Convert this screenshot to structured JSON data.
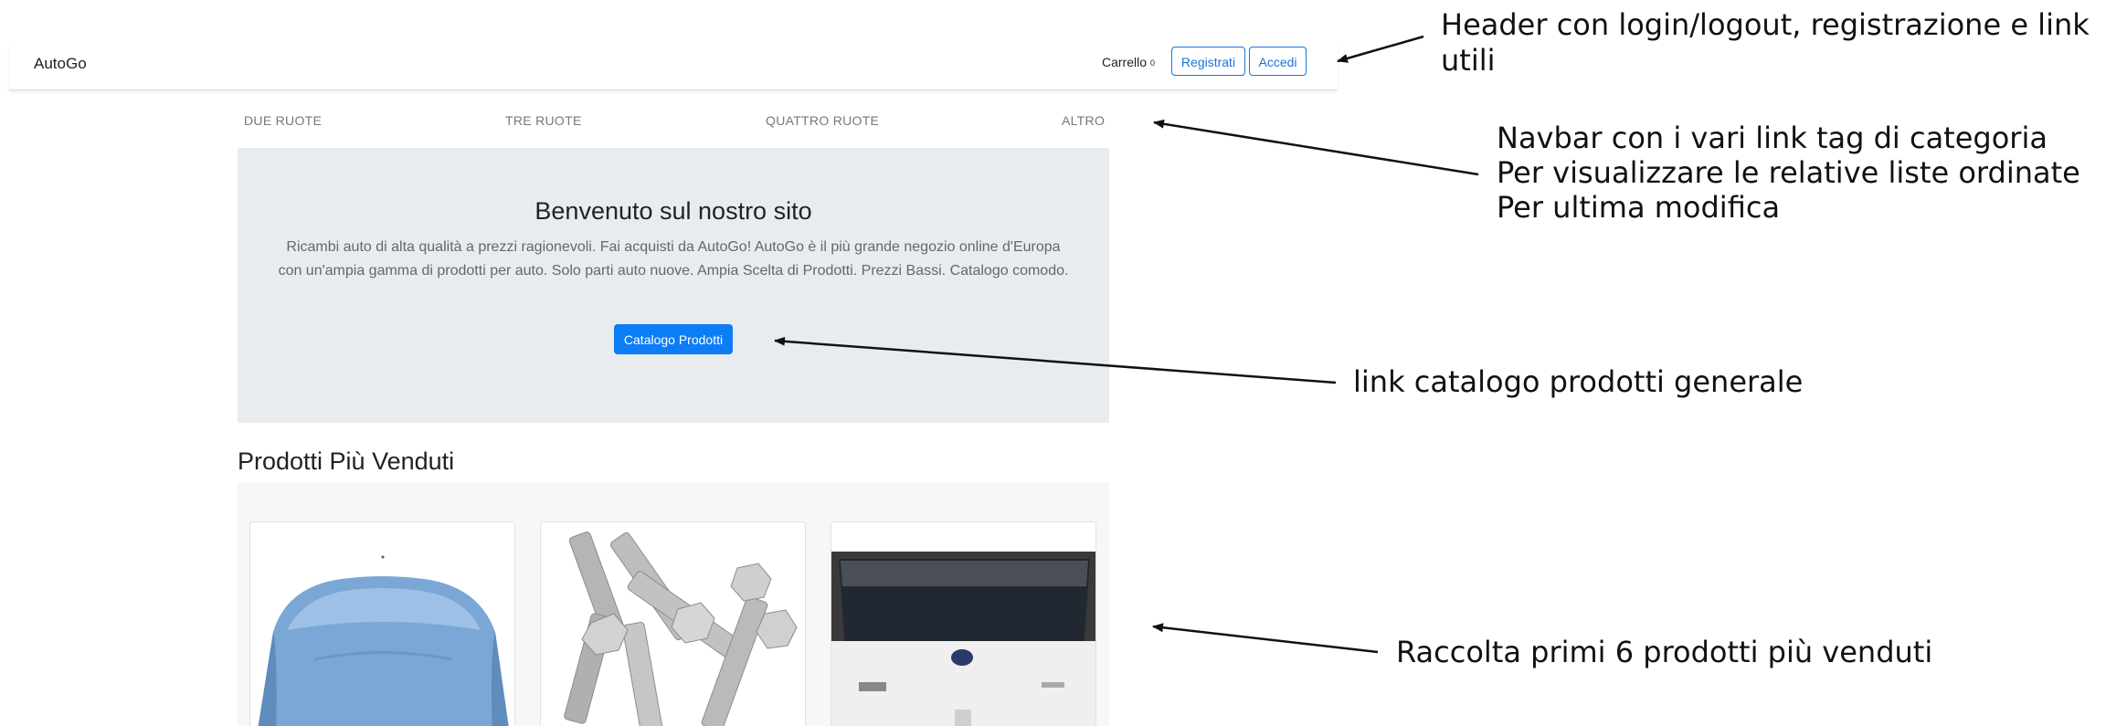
{
  "header": {
    "brand": "AutoGo",
    "cart_label": "Carrello",
    "cart_count": "0",
    "register_label": "Registrati",
    "login_label": "Accedi"
  },
  "category_nav": [
    "DUE RUOTE",
    "TRE RUOTE",
    "QUATTRO RUOTE",
    "ALTRO"
  ],
  "hero": {
    "title": "Benvenuto sul nostro sito",
    "text": "Ricambi auto di alta qualità a prezzi ragionevoli. Fai acquisti da AutoGo! AutoGo è il più grande negozio online d'Europa con un'ampia gamma di prodotti per auto. Solo parti auto nuove. Ampia Scelta di Prodotti. Prezzi Bassi. Catalogo comodo.",
    "button_label": "Catalogo Prodotti"
  },
  "best_sellers": {
    "title": "Prodotti Più Venduti",
    "products": [
      {
        "image": "blue-car-hood"
      },
      {
        "image": "steel-bolts"
      },
      {
        "image": "white-car-tailgate"
      }
    ]
  },
  "annotations": {
    "header_note": "Header con login/logout, registrazione e link utili",
    "navbar_note_1": "Navbar con i vari link tag di categoria",
    "navbar_note_2": "Per visualizzare le relative liste ordinate",
    "navbar_note_3": "Per ultima modifica",
    "catalog_note": "link catalogo prodotti generale",
    "products_note": "Raccolta primi 6 prodotti più venduti"
  },
  "colors": {
    "primary": "#0d7df5",
    "hero_bg": "#e9ecef",
    "products_bg": "#f7f7f7"
  }
}
